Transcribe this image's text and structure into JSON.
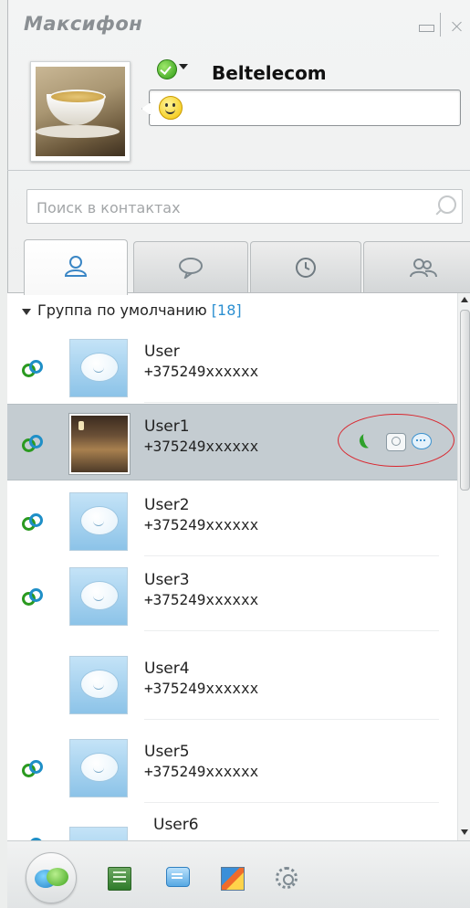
{
  "window": {
    "title": "Максифон"
  },
  "profile": {
    "name": "Beltelecom",
    "mood_text": "",
    "status": "online",
    "status_icon": "green-check-icon",
    "mood_icon": "smiley-icon"
  },
  "search": {
    "placeholder": "Поиск в контактах",
    "value": ""
  },
  "tabs": [
    {
      "id": "contacts",
      "icon": "person-icon",
      "active": true
    },
    {
      "id": "chat",
      "icon": "speech-bubble-icon",
      "active": false
    },
    {
      "id": "history",
      "icon": "clock-icon",
      "active": false
    },
    {
      "id": "groups",
      "icon": "people-icon",
      "active": false
    }
  ],
  "group": {
    "name": "Группа по умолчанию",
    "count": "[18]"
  },
  "contacts": [
    {
      "name": "User",
      "phone": "+375249xxxxxx",
      "online": true,
      "photo": false,
      "selected": false
    },
    {
      "name": "User1",
      "phone": "+375249xxxxxx",
      "online": true,
      "photo": true,
      "selected": true
    },
    {
      "name": "User2",
      "phone": "+375249xxxxxx",
      "online": true,
      "photo": false,
      "selected": false
    },
    {
      "name": "User3",
      "phone": "+375249xxxxxx",
      "online": true,
      "photo": false,
      "selected": false
    },
    {
      "name": "User4",
      "phone": "+375249xxxxxx",
      "online": false,
      "photo": false,
      "selected": false
    },
    {
      "name": "User5",
      "phone": "+375249xxxxxx",
      "online": true,
      "photo": false,
      "selected": false
    },
    {
      "name": "User6",
      "phone": "",
      "online": true,
      "photo": false,
      "selected": false
    }
  ],
  "colors": {
    "accent_blue": "#2c8fd1",
    "online_green": "#2b9a20",
    "highlight_red": "#d9262e",
    "selected_row": "#c4ccd1"
  }
}
